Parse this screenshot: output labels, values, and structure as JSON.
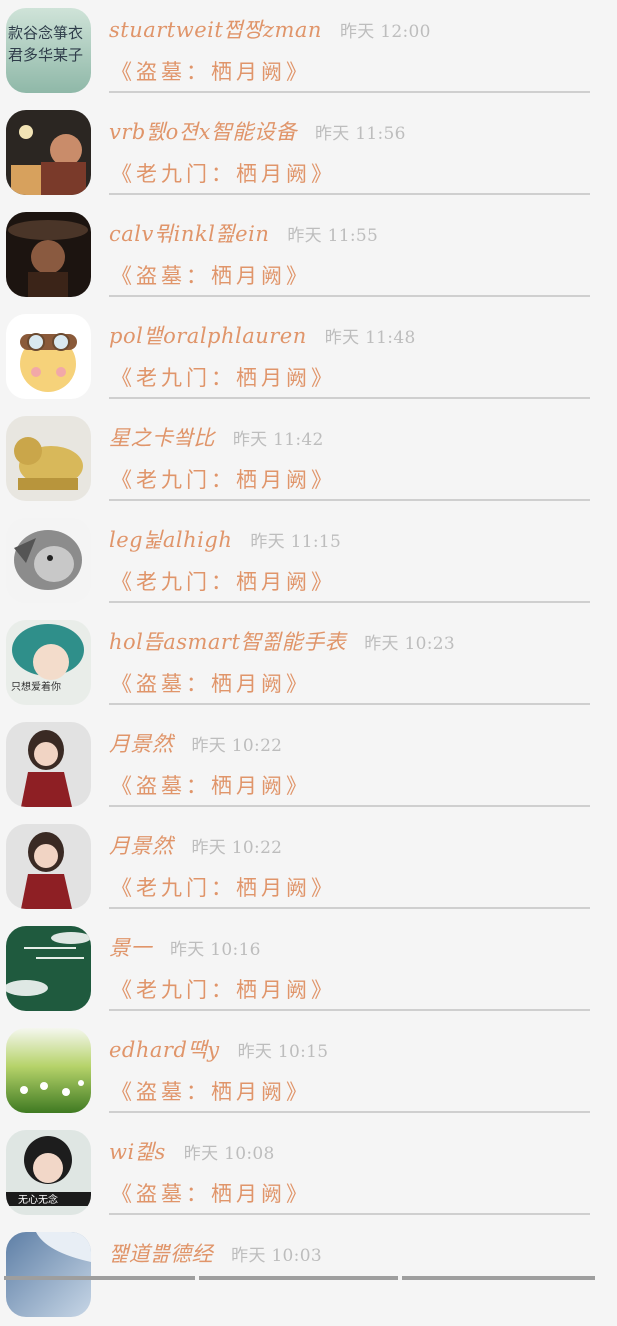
{
  "messages": [
    {
      "name": "stuartweit쩝짱zman",
      "time": "昨天 12:00",
      "title": "《盗墓：栖月阙》",
      "avatar": "calligraphy-avatar"
    },
    {
      "name": "vrb뛠o젼x智能设备",
      "time": "昨天 11:56",
      "title": "《老九门：栖月阙》",
      "avatar": "night-figure-avatar"
    },
    {
      "name": "calv뮊inkl쬞ein",
      "time": "昨天 11:55",
      "title": "《盗墓：栖月阙》",
      "avatar": "dark-portrait-avatar"
    },
    {
      "name": "pol뱉oralphlauren",
      "time": "昨天 11:48",
      "title": "《老九门：栖月阙》",
      "avatar": "cartoon-pilot-avatar"
    },
    {
      "name": "星之卡쐌比",
      "time": "昨天 11:42",
      "title": "《老九门：栖月阙》",
      "avatar": "golden-lion-avatar"
    },
    {
      "name": "leg뉥alhigh",
      "time": "昨天 11:15",
      "title": "《老九门：栖月阙》",
      "avatar": "lion-sketch-avatar"
    },
    {
      "name": "hol뜹asmart智쬚能手表",
      "time": "昨天 10:23",
      "title": "《盗墓：栖月阙》",
      "avatar": "teal-hair-girl-avatar",
      "avatar_caption": "只想爱着你"
    },
    {
      "name": "月景然",
      "time": "昨天 10:22",
      "title": "《盗墓：栖月阙》",
      "avatar": "woman-red-dress-avatar"
    },
    {
      "name": "月景然",
      "time": "昨天 10:22",
      "title": "《老九门：栖月阙》",
      "avatar": "woman-red-dress-avatar"
    },
    {
      "name": "景一",
      "time": "昨天 10:16",
      "title": "《老九门：栖月阙》",
      "avatar": "green-landscape-avatar"
    },
    {
      "name": "edhard땍y",
      "time": "昨天 10:15",
      "title": "《盗墓：栖月阙》",
      "avatar": "daisy-field-avatar"
    },
    {
      "name": "wi켍s",
      "time": "昨天 10:08",
      "title": "《盗墓：栖月阙》",
      "avatar": "girl-portrait-avatar",
      "avatar_caption": "无心无念"
    },
    {
      "name": "쨅道쁢德经",
      "time": "昨天 10:03",
      "title": "",
      "avatar": "blue-sky-avatar"
    }
  ],
  "colors": {
    "accent": "#e0956a",
    "time": "#bdbdbd",
    "divider": "#cfcfcf",
    "background": "#f5f5f5"
  }
}
